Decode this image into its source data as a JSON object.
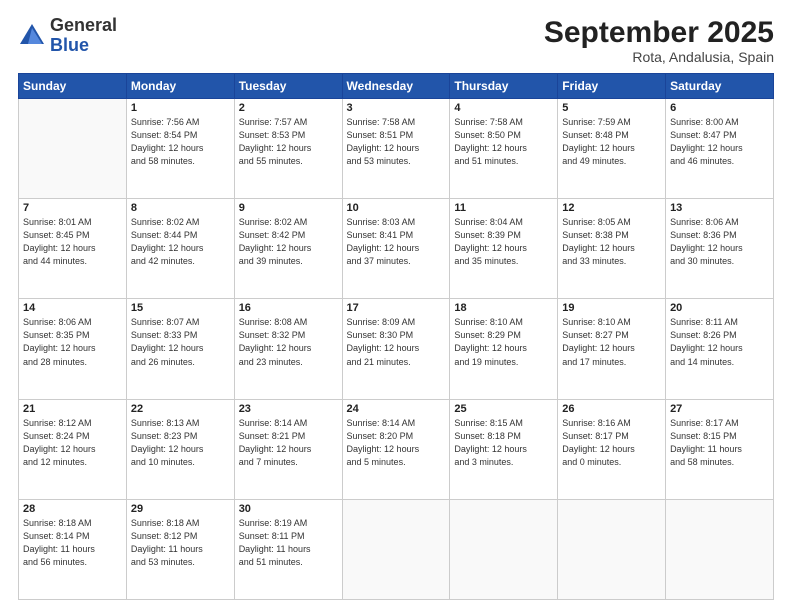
{
  "logo": {
    "line1": "General",
    "line2": "Blue"
  },
  "header": {
    "title": "September 2025",
    "subtitle": "Rota, Andalusia, Spain"
  },
  "weekdays": [
    "Sunday",
    "Monday",
    "Tuesday",
    "Wednesday",
    "Thursday",
    "Friday",
    "Saturday"
  ],
  "weeks": [
    [
      {
        "day": "",
        "info": ""
      },
      {
        "day": "1",
        "info": "Sunrise: 7:56 AM\nSunset: 8:54 PM\nDaylight: 12 hours\nand 58 minutes."
      },
      {
        "day": "2",
        "info": "Sunrise: 7:57 AM\nSunset: 8:53 PM\nDaylight: 12 hours\nand 55 minutes."
      },
      {
        "day": "3",
        "info": "Sunrise: 7:58 AM\nSunset: 8:51 PM\nDaylight: 12 hours\nand 53 minutes."
      },
      {
        "day": "4",
        "info": "Sunrise: 7:58 AM\nSunset: 8:50 PM\nDaylight: 12 hours\nand 51 minutes."
      },
      {
        "day": "5",
        "info": "Sunrise: 7:59 AM\nSunset: 8:48 PM\nDaylight: 12 hours\nand 49 minutes."
      },
      {
        "day": "6",
        "info": "Sunrise: 8:00 AM\nSunset: 8:47 PM\nDaylight: 12 hours\nand 46 minutes."
      }
    ],
    [
      {
        "day": "7",
        "info": "Sunrise: 8:01 AM\nSunset: 8:45 PM\nDaylight: 12 hours\nand 44 minutes."
      },
      {
        "day": "8",
        "info": "Sunrise: 8:02 AM\nSunset: 8:44 PM\nDaylight: 12 hours\nand 42 minutes."
      },
      {
        "day": "9",
        "info": "Sunrise: 8:02 AM\nSunset: 8:42 PM\nDaylight: 12 hours\nand 39 minutes."
      },
      {
        "day": "10",
        "info": "Sunrise: 8:03 AM\nSunset: 8:41 PM\nDaylight: 12 hours\nand 37 minutes."
      },
      {
        "day": "11",
        "info": "Sunrise: 8:04 AM\nSunset: 8:39 PM\nDaylight: 12 hours\nand 35 minutes."
      },
      {
        "day": "12",
        "info": "Sunrise: 8:05 AM\nSunset: 8:38 PM\nDaylight: 12 hours\nand 33 minutes."
      },
      {
        "day": "13",
        "info": "Sunrise: 8:06 AM\nSunset: 8:36 PM\nDaylight: 12 hours\nand 30 minutes."
      }
    ],
    [
      {
        "day": "14",
        "info": "Sunrise: 8:06 AM\nSunset: 8:35 PM\nDaylight: 12 hours\nand 28 minutes."
      },
      {
        "day": "15",
        "info": "Sunrise: 8:07 AM\nSunset: 8:33 PM\nDaylight: 12 hours\nand 26 minutes."
      },
      {
        "day": "16",
        "info": "Sunrise: 8:08 AM\nSunset: 8:32 PM\nDaylight: 12 hours\nand 23 minutes."
      },
      {
        "day": "17",
        "info": "Sunrise: 8:09 AM\nSunset: 8:30 PM\nDaylight: 12 hours\nand 21 minutes."
      },
      {
        "day": "18",
        "info": "Sunrise: 8:10 AM\nSunset: 8:29 PM\nDaylight: 12 hours\nand 19 minutes."
      },
      {
        "day": "19",
        "info": "Sunrise: 8:10 AM\nSunset: 8:27 PM\nDaylight: 12 hours\nand 17 minutes."
      },
      {
        "day": "20",
        "info": "Sunrise: 8:11 AM\nSunset: 8:26 PM\nDaylight: 12 hours\nand 14 minutes."
      }
    ],
    [
      {
        "day": "21",
        "info": "Sunrise: 8:12 AM\nSunset: 8:24 PM\nDaylight: 12 hours\nand 12 minutes."
      },
      {
        "day": "22",
        "info": "Sunrise: 8:13 AM\nSunset: 8:23 PM\nDaylight: 12 hours\nand 10 minutes."
      },
      {
        "day": "23",
        "info": "Sunrise: 8:14 AM\nSunset: 8:21 PM\nDaylight: 12 hours\nand 7 minutes."
      },
      {
        "day": "24",
        "info": "Sunrise: 8:14 AM\nSunset: 8:20 PM\nDaylight: 12 hours\nand 5 minutes."
      },
      {
        "day": "25",
        "info": "Sunrise: 8:15 AM\nSunset: 8:18 PM\nDaylight: 12 hours\nand 3 minutes."
      },
      {
        "day": "26",
        "info": "Sunrise: 8:16 AM\nSunset: 8:17 PM\nDaylight: 12 hours\nand 0 minutes."
      },
      {
        "day": "27",
        "info": "Sunrise: 8:17 AM\nSunset: 8:15 PM\nDaylight: 11 hours\nand 58 minutes."
      }
    ],
    [
      {
        "day": "28",
        "info": "Sunrise: 8:18 AM\nSunset: 8:14 PM\nDaylight: 11 hours\nand 56 minutes."
      },
      {
        "day": "29",
        "info": "Sunrise: 8:18 AM\nSunset: 8:12 PM\nDaylight: 11 hours\nand 53 minutes."
      },
      {
        "day": "30",
        "info": "Sunrise: 8:19 AM\nSunset: 8:11 PM\nDaylight: 11 hours\nand 51 minutes."
      },
      {
        "day": "",
        "info": ""
      },
      {
        "day": "",
        "info": ""
      },
      {
        "day": "",
        "info": ""
      },
      {
        "day": "",
        "info": ""
      }
    ]
  ]
}
